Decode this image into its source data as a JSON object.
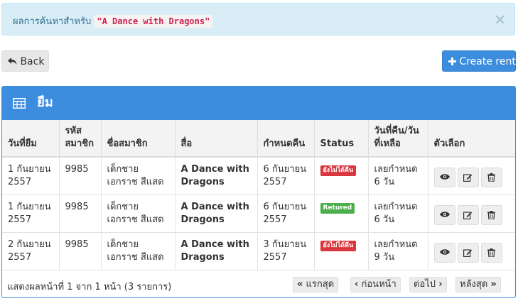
{
  "alert": {
    "prefix": "ผลการค้นหาสำหรับ",
    "query": "\"A Dance with Dragons\"",
    "close": "×"
  },
  "toolbar": {
    "back_label": "Back",
    "create_label": "Create rent"
  },
  "panel": {
    "title": "ยืม"
  },
  "table": {
    "headers": [
      "วันที่ยืม",
      "รหัส สมาชิก",
      "ชื่อสมาชิก",
      "สื่อ",
      "กำหนดคืน",
      "Status",
      "วันที่คืน/วันที่เหลือ",
      "ตัวเลือก"
    ],
    "rows": [
      {
        "borrow_date": "1 กันยายน 2557",
        "member_id": "9985",
        "member_name": "เด็กชาย เอกราช สีแสด",
        "media": "A Dance with Dragons",
        "due_date": "6 กันยายน 2557",
        "status": "ยังไม่ได้คืน",
        "status_color": "#d9363e",
        "remaining": "เลยกำหนด 6 วัน"
      },
      {
        "borrow_date": "1 กันยายน 2557",
        "member_id": "9985",
        "member_name": "เด็กชาย เอกราช สีแสด",
        "media": "A Dance with Dragons",
        "due_date": "6 กันยายน 2557",
        "status": "Retured",
        "status_color": "#4cae4c",
        "remaining": "เลยกำหนด 6 วัน"
      },
      {
        "borrow_date": "2 กันยายน 2557",
        "member_id": "9985",
        "member_name": "เด็กชาย เอกราช สีแสด",
        "media": "A Dance with Dragons",
        "due_date": "3 กันยายน 2557",
        "status": "ยังไม่ได้คืน",
        "status_color": "#d9363e",
        "remaining": "เลยกำหนด 9 วัน"
      }
    ]
  },
  "footer": {
    "info": "แสดงผลหน้าที่ 1 จาก 1 หน้า (3 รายการ)",
    "first": "แรกสุด",
    "prev": "ก่อนหน้า",
    "next": "ต่อไป",
    "last": "หลังสุด"
  },
  "colors": {
    "primary": "#3c8dde",
    "alert_bg": "#d9edf7",
    "danger": "#d9363e",
    "success": "#4cae4c"
  },
  "icons": [
    "close-icon",
    "reply-arrow-icon",
    "plus-icon",
    "table-icon",
    "eye-icon",
    "edit-icon",
    "trash-icon",
    "double-chevron-left-icon",
    "chevron-left-icon",
    "chevron-right-icon",
    "double-chevron-right-icon"
  ]
}
